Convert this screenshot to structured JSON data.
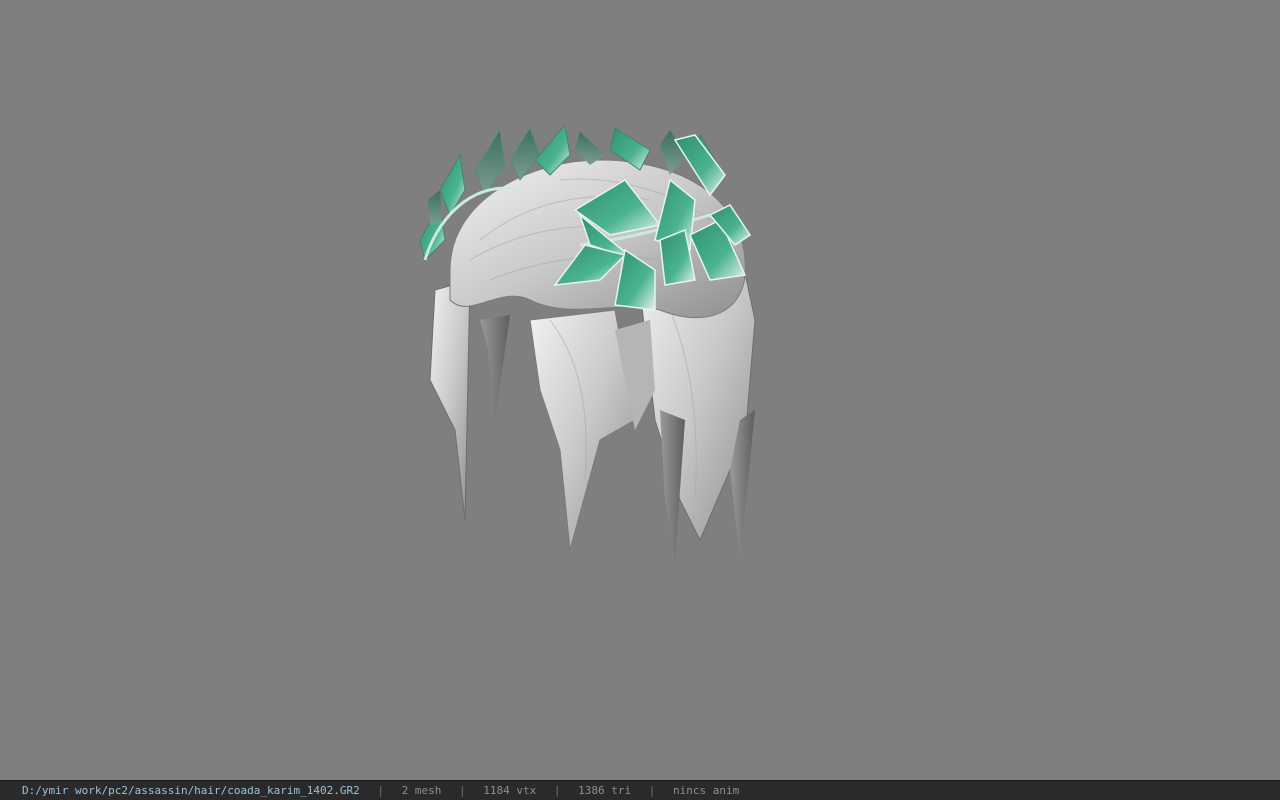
{
  "viewport": {
    "background_color": "#7f7f7f",
    "model": {
      "hair_color": "#d8d8d8",
      "leaf_color": "#3fa987",
      "leaf_highlight": "#d9efe6"
    }
  },
  "statusbar": {
    "file_path": "D:/ymir work/pc2/assassin/hair/coada_karim_1402.GR2",
    "separator": "|",
    "mesh_count": "2 mesh",
    "vertex_count": "1184 vtx",
    "triangle_count": "1386 tri",
    "animation_status": "nincs anim"
  }
}
